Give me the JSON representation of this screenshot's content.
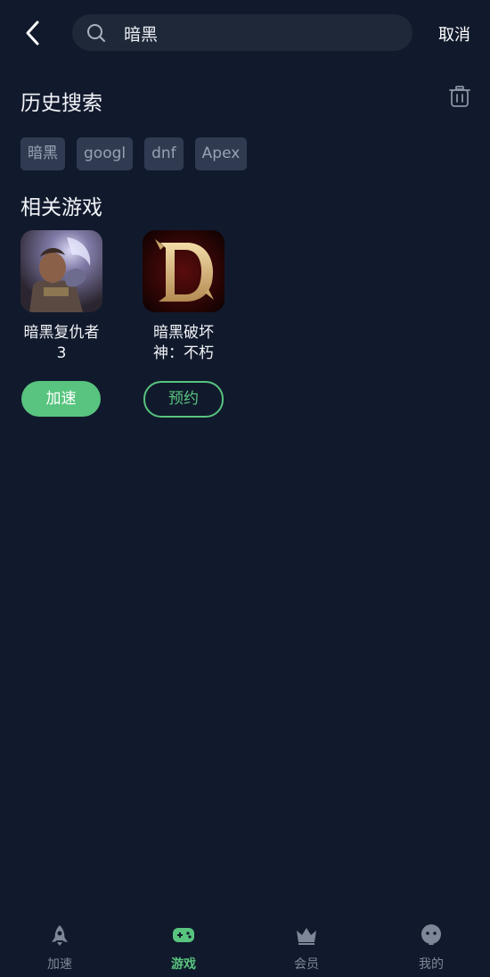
{
  "header": {
    "back_icon": "chevron-left-icon",
    "search_icon": "search-icon",
    "search_value": "暗黑",
    "cancel_label": "取消"
  },
  "history": {
    "title": "历史搜索",
    "delete_icon": "trash-icon",
    "items": [
      "暗黑",
      "googl",
      "dnf",
      "Apex"
    ]
  },
  "related": {
    "title": "相关游戏",
    "games": [
      {
        "name": "暗黑复仇者3",
        "action": "加速",
        "action_type": "primary"
      },
      {
        "name": "暗黑破坏神：不朽",
        "action": "预约",
        "action_type": "outline"
      }
    ]
  },
  "tabbar": {
    "active_color": "#58c47f",
    "items": [
      {
        "label": "加速",
        "icon": "rocket-icon"
      },
      {
        "label": "游戏",
        "icon": "gamepad-icon",
        "active": true
      },
      {
        "label": "会员",
        "icon": "crown-icon"
      },
      {
        "label": "我的",
        "icon": "face-icon"
      }
    ]
  }
}
